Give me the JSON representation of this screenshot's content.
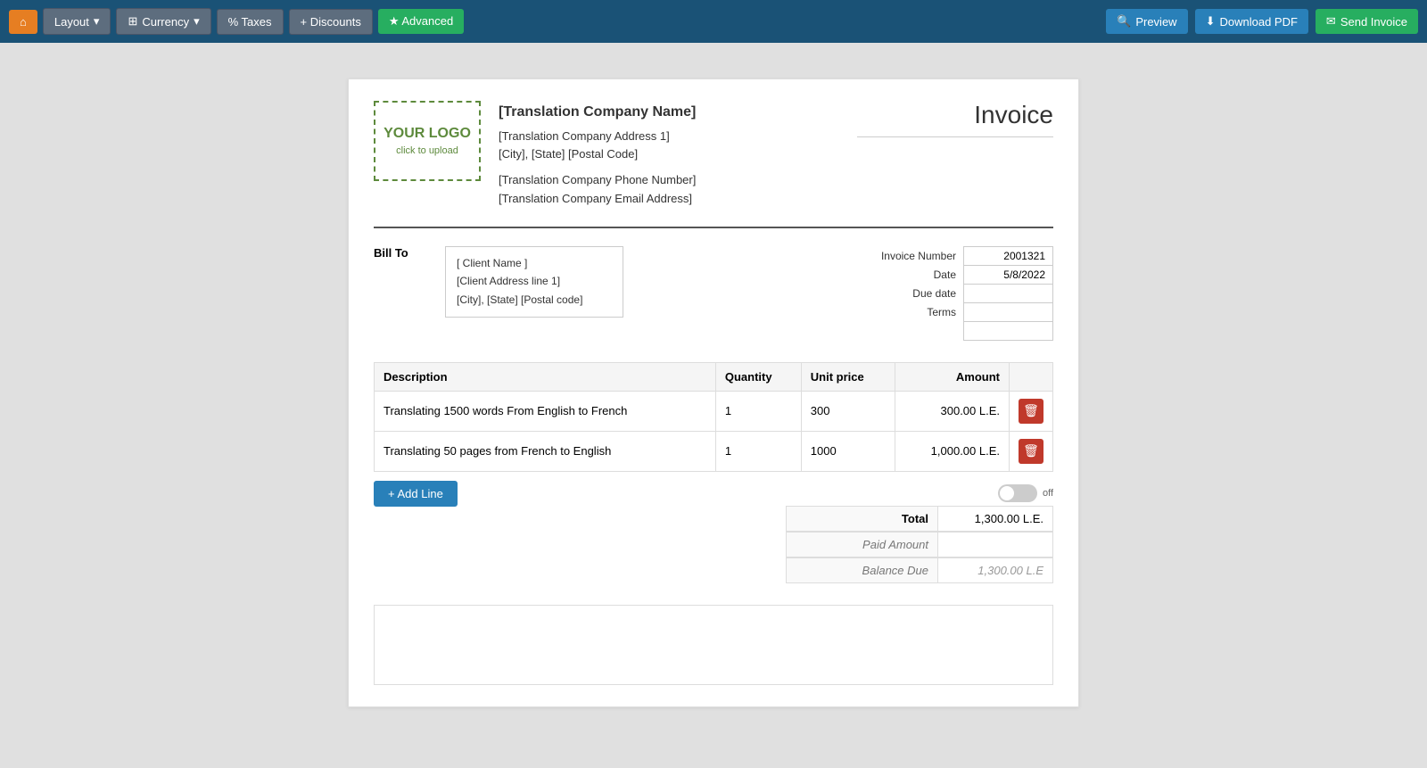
{
  "toolbar": {
    "home_icon": "⌂",
    "layout_label": "Layout",
    "currency_label": "Currency",
    "taxes_label": "% Taxes",
    "discounts_label": "+ Discounts",
    "advanced_label": "★ Advanced",
    "preview_label": "Preview",
    "download_pdf_label": "Download PDF",
    "send_invoice_label": "Send Invoice"
  },
  "invoice": {
    "logo_text": "YOUR LOGO",
    "logo_sub": "click to upload",
    "company_name": "[Translation Company Name]",
    "company_address1": "[Translation Company Address 1]",
    "company_city": "[City], [State] [Postal Code]",
    "company_phone": "[Translation Company Phone Number]",
    "company_email": "[Translation Company Email Address]",
    "title": "Invoice",
    "bill_to_label": "Bill To",
    "client_name": "[ Client Name ]",
    "client_address1": "[Client Address line 1]",
    "client_city": "[City], [State] [Postal code]",
    "invoice_number_label": "Invoice Number",
    "invoice_number_value": "2001321",
    "date_label": "Date",
    "date_value": "5/8/2022",
    "due_date_label": "Due date",
    "due_date_value": "",
    "terms_label": "Terms",
    "terms_value": "",
    "extra_label1": "",
    "extra_value1": "",
    "extra_label2": "",
    "extra_value2": "",
    "columns": {
      "description": "Description",
      "quantity": "Quantity",
      "unit_price": "Unit price",
      "amount": "Amount"
    },
    "line_items": [
      {
        "description": "Translating 1500 words From English to French",
        "quantity": "1",
        "unit_price": "300",
        "amount": "300.00 L.E."
      },
      {
        "description": "Translating 50 pages from French to English",
        "quantity": "1",
        "unit_price": "1000",
        "amount": "1,000.00 L.E."
      }
    ],
    "add_line_label": "+ Add Line",
    "toggle_label": "off",
    "total_label": "Total",
    "total_value": "1,300.00 L.E.",
    "paid_amount_label": "Paid Amount",
    "paid_amount_value": "",
    "balance_due_label": "Balance Due",
    "balance_due_value": "1,300.00 L.E"
  }
}
